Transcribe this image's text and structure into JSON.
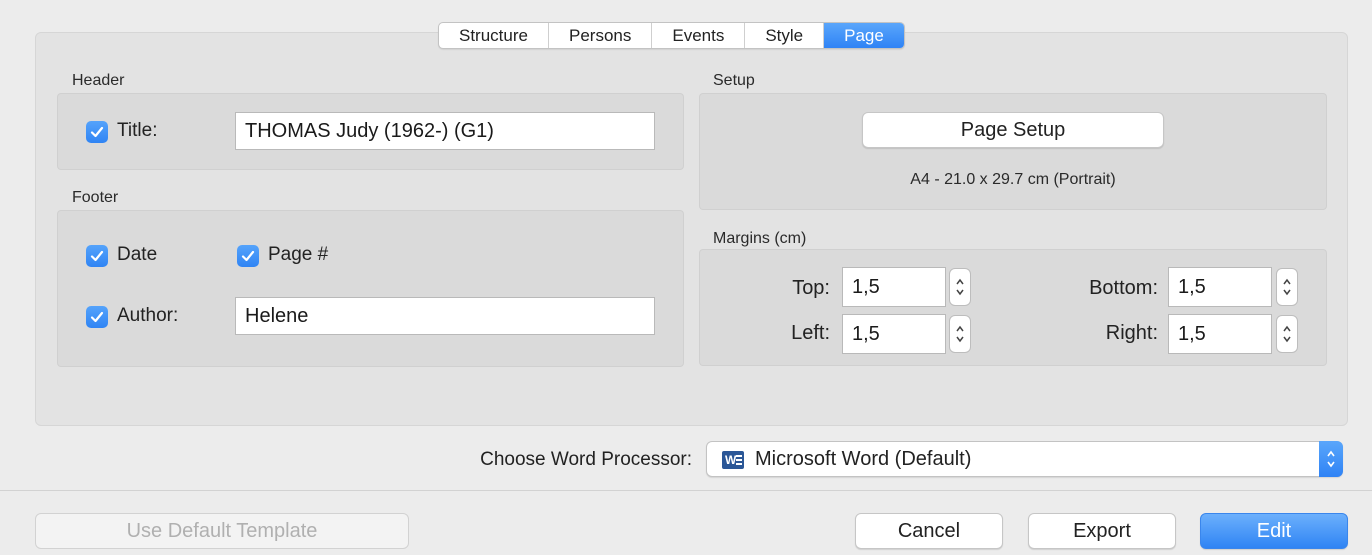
{
  "tabs": [
    "Structure",
    "Persons",
    "Events",
    "Style",
    "Page"
  ],
  "active_tab": "Page",
  "header": {
    "section_label": "Header",
    "title_label": "Title:",
    "title_value": "THOMAS Judy (1962-) (G1)",
    "title_checked": true
  },
  "footer": {
    "section_label": "Footer",
    "date_label": "Date",
    "date_checked": true,
    "page_label": "Page #",
    "page_checked": true,
    "author_label": "Author:",
    "author_value": "Helene",
    "author_checked": true
  },
  "setup": {
    "section_label": "Setup",
    "button_label": "Page Setup",
    "paper_info": "A4 - 21.0 x 29.7 cm (Portrait)"
  },
  "margins": {
    "section_label": "Margins (cm)",
    "top_label": "Top:",
    "top_value": "1,5",
    "left_label": "Left:",
    "left_value": "1,5",
    "bottom_label": "Bottom:",
    "bottom_value": "1,5",
    "right_label": "Right:",
    "right_value": "1,5"
  },
  "word_processor": {
    "label": "Choose Word Processor:",
    "value": "Microsoft Word (Default)",
    "icon": "word-icon"
  },
  "buttons": {
    "default_template": "Use Default Template",
    "cancel": "Cancel",
    "export": "Export",
    "edit": "Edit"
  },
  "colors": {
    "accent": "#2f84f4",
    "background": "#ececec"
  }
}
